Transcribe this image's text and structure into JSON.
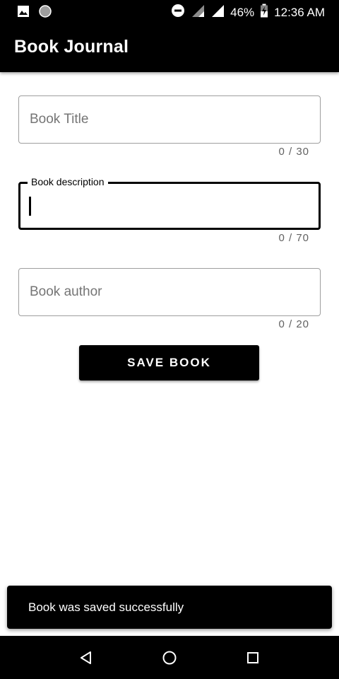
{
  "status_bar": {
    "battery": "46%",
    "time": "12:36 AM"
  },
  "app_bar": {
    "title": "Book Journal"
  },
  "form": {
    "title_field": {
      "placeholder": "Book Title",
      "value": "",
      "counter": "0 / 30"
    },
    "description_field": {
      "label": "Book description",
      "value": "",
      "counter": "0 / 70",
      "focused": true
    },
    "author_field": {
      "placeholder": "Book author",
      "value": "",
      "counter": "0 / 20"
    },
    "save_label": "SAVE BOOK"
  },
  "snackbar": {
    "message": "Book was saved successfully"
  },
  "icons": {
    "status_left": [
      "image-icon",
      "sync-circle-icon"
    ],
    "status_right": [
      "do-not-disturb-icon",
      "signal-icon",
      "signal-icon",
      "battery-charging-icon"
    ],
    "nav": [
      "back-icon",
      "home-icon",
      "recents-icon"
    ]
  },
  "colors": {
    "primary": "#000000",
    "background": "#ffffff",
    "outline": "#9e9e9e",
    "hint_text": "#757575"
  }
}
